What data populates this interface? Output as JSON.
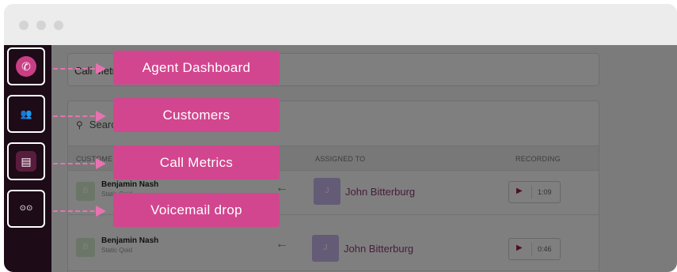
{
  "colors": {
    "callout_bg": "#d2468f",
    "connector": "#e872b1",
    "sidebar_bg": "#1d0b17",
    "accent": "#9c1f4b"
  },
  "page": {
    "title": "Call Metrics",
    "search_placeholder": "Search",
    "search_icon": "search-icon"
  },
  "table": {
    "headers": {
      "customer": "CUSTOMER",
      "assigned_to": "ASSIGNED TO",
      "recording": "RECORDING"
    },
    "rows": [
      {
        "initial": "B",
        "name": "Benjamin Nash",
        "sub": "Static Qoid",
        "direction": "←",
        "agent_initial": "J",
        "agent": "John Bitterburg",
        "duration": "1:09"
      },
      {
        "initial": "B",
        "name": "Benjamin Nash",
        "sub": "Static Qoid",
        "direction": "←",
        "agent_initial": "J",
        "agent": "John Bitterburg",
        "duration": "0:46"
      }
    ]
  },
  "sidebar": {
    "items": [
      {
        "icon": "phone-icon",
        "glyph": "✆"
      },
      {
        "icon": "users-icon",
        "glyph": "👥"
      },
      {
        "icon": "contact-card-icon",
        "glyph": "▤"
      },
      {
        "icon": "voicemail-icon",
        "glyph": "⊙⊙"
      }
    ]
  },
  "callouts": [
    {
      "label": "Agent Dashboard"
    },
    {
      "label": "Customers"
    },
    {
      "label": "Call Metrics"
    },
    {
      "label": "Voicemail drop"
    }
  ]
}
